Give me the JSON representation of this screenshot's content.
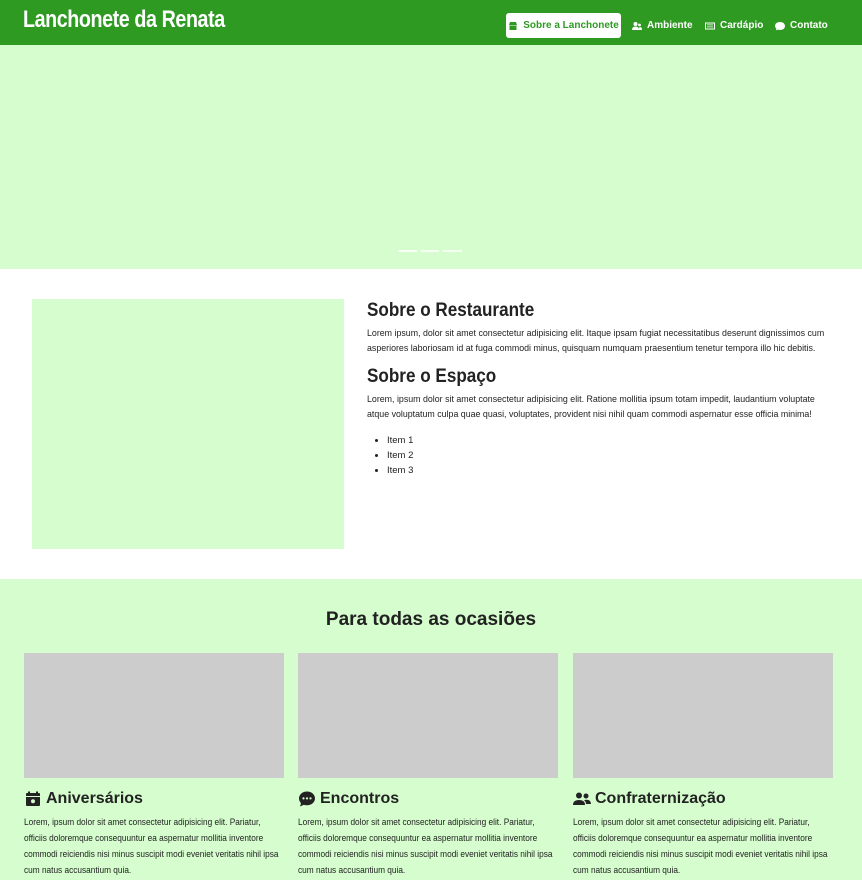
{
  "brand": "Lanchonete da Renata",
  "nav": {
    "items": [
      {
        "label": "Sobre a Lanchonete",
        "icon": "store-icon",
        "active": true
      },
      {
        "label": "Ambiente",
        "icon": "people-icon",
        "active": false
      },
      {
        "label": "Cardápio",
        "icon": "menu-list-icon",
        "active": false
      },
      {
        "label": "Contato",
        "icon": "chat-bubble-icon",
        "active": false
      }
    ]
  },
  "about": {
    "title": "Sobre o Restaurante",
    "text": "Lorem ipsum, dolor sit amet consectetur adipisicing elit. Itaque ipsam fugiat necessitatibus deserunt dignissimos cum asperiores laboriosam id at fuga commodi minus, quisquam numquam praesentium tenetur tempora illo hic debitis.",
    "space_title": "Sobre o Espaço",
    "space_text": "Lorem, ipsum dolor sit amet consectetur adipisicing elit. Ratione mollitia ipsum totam impedit, laudantium voluptate atque voluptatum culpa quae quasi, voluptates, provident nisi nihil quam commodi aspernatur esse officia minima!",
    "items": [
      "Item 1",
      "Item 2",
      "Item 3"
    ]
  },
  "occasions": {
    "title": "Para todas as ocasiões",
    "cards": [
      {
        "title": "Aniversários",
        "icon": "calendar-icon",
        "text": "Lorem, ipsum dolor sit amet consectetur adipisicing elit. Pariatur, officiis doloremque consequuntur ea aspernatur mollitia inventore commodi reiciendis nisi minus suscipit modi eveniet veritatis nihil ipsa cum natus accusantium quia."
      },
      {
        "title": "Encontros",
        "icon": "speech-bubble-icon",
        "text": "Lorem, ipsum dolor sit amet consectetur adipisicing elit. Pariatur, officiis doloremque consequuntur ea aspernatur mollitia inventore commodi reiciendis nisi minus suscipit modi eveniet veritatis nihil ipsa cum natus accusantium quia."
      },
      {
        "title": "Confraternização",
        "icon": "group-icon",
        "text": "Lorem, ipsum dolor sit amet consectetur adipisicing elit. Pariatur, officiis doloremque consequuntur ea aspernatur mollitia inventore commodi reiciendis nisi minus suscipit modi eveniet veritatis nihil ipsa cum natus accusantium quia."
      }
    ]
  },
  "colors": {
    "navbar": "#2e9a22",
    "light_green": "#d5fdcd",
    "placeholder_gray": "#cccccc"
  }
}
